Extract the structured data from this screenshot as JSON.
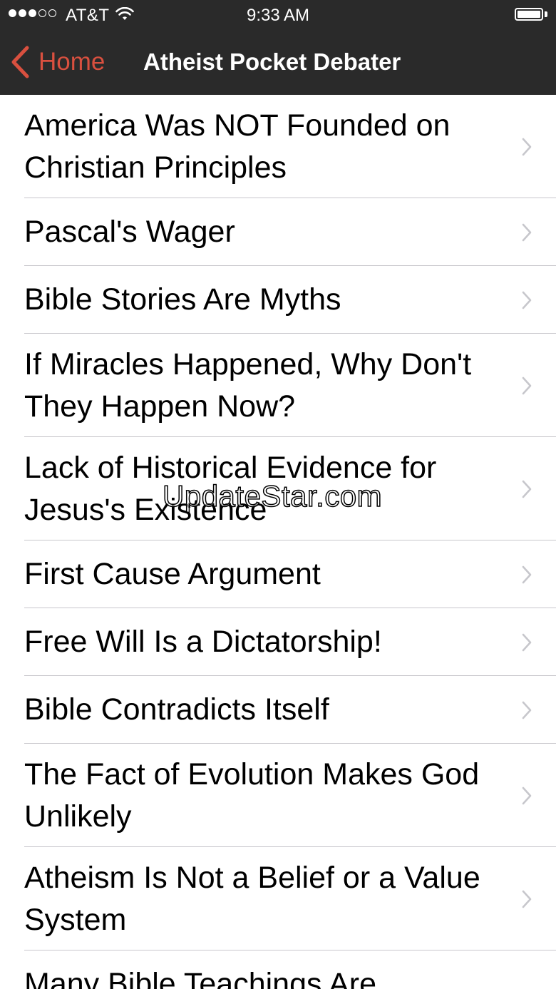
{
  "status_bar": {
    "carrier": "AT&T",
    "time": "9:33 AM",
    "signal_bars": 3,
    "signal_total": 5
  },
  "nav_bar": {
    "back_label": "Home",
    "title": "Atheist Pocket Debater"
  },
  "list": {
    "items": [
      {
        "label": "America Was NOT Founded on Christian Principles"
      },
      {
        "label": "Pascal's Wager"
      },
      {
        "label": "Bible Stories Are Myths"
      },
      {
        "label": "If Miracles Happened, Why Don't They Happen Now?"
      },
      {
        "label": "Lack of Historical Evidence for Jesus's Existence"
      },
      {
        "label": "First Cause Argument"
      },
      {
        "label": "Free Will Is a Dictatorship!"
      },
      {
        "label": "Bible Contradicts Itself"
      },
      {
        "label": "The Fact of Evolution Makes God Unlikely"
      },
      {
        "label": "Atheism Is Not a Belief or a Value System"
      },
      {
        "label": "Many Bible Teachings Are"
      }
    ]
  },
  "watermark": {
    "text": "UpdateStar.com"
  },
  "colors": {
    "bar_background": "#2a2a2a",
    "accent": "#d9503f",
    "separator": "#c8c7cc",
    "chevron": "#c7c7cc"
  },
  "icons": {
    "back": "chevron-left-icon",
    "row": "chevron-right-icon",
    "wifi": "wifi-icon",
    "battery": "battery-icon"
  }
}
